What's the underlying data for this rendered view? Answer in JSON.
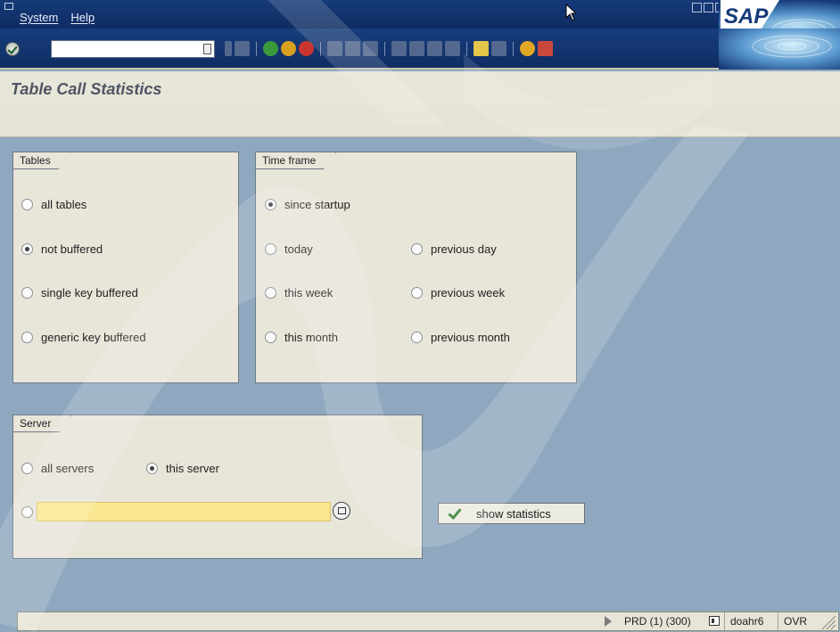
{
  "menu": [
    "System",
    "Help"
  ],
  "page_title": "Table Call Statistics",
  "tables_group": {
    "title": "Tables",
    "options": [
      {
        "label": "all tables",
        "selected": false
      },
      {
        "label": "not buffered",
        "selected": true
      },
      {
        "label": "single key buffered",
        "selected": false
      },
      {
        "label": "generic key buffered",
        "selected": false
      }
    ]
  },
  "timeframe_group": {
    "title": "Time frame",
    "options": [
      {
        "label": "since startup",
        "selected": true
      },
      {
        "label": "today",
        "selected": false
      },
      {
        "label": "previous day",
        "selected": false
      },
      {
        "label": "this week",
        "selected": false
      },
      {
        "label": "previous week",
        "selected": false
      },
      {
        "label": "this month",
        "selected": false
      },
      {
        "label": "previous month",
        "selected": false
      }
    ]
  },
  "server_group": {
    "title": "Server",
    "all_servers": "all servers",
    "this_server": "this server",
    "server_value": ""
  },
  "show_button": "show statistics",
  "status": {
    "system": "PRD (1) (300)",
    "user": "doahr6",
    "mode": "OVR"
  },
  "logo": "SAP",
  "colors": {
    "titlebar": "#163a78",
    "background": "#8fa8bf",
    "panel": "#e8e5d9",
    "input_highlight": "#fae78f"
  }
}
